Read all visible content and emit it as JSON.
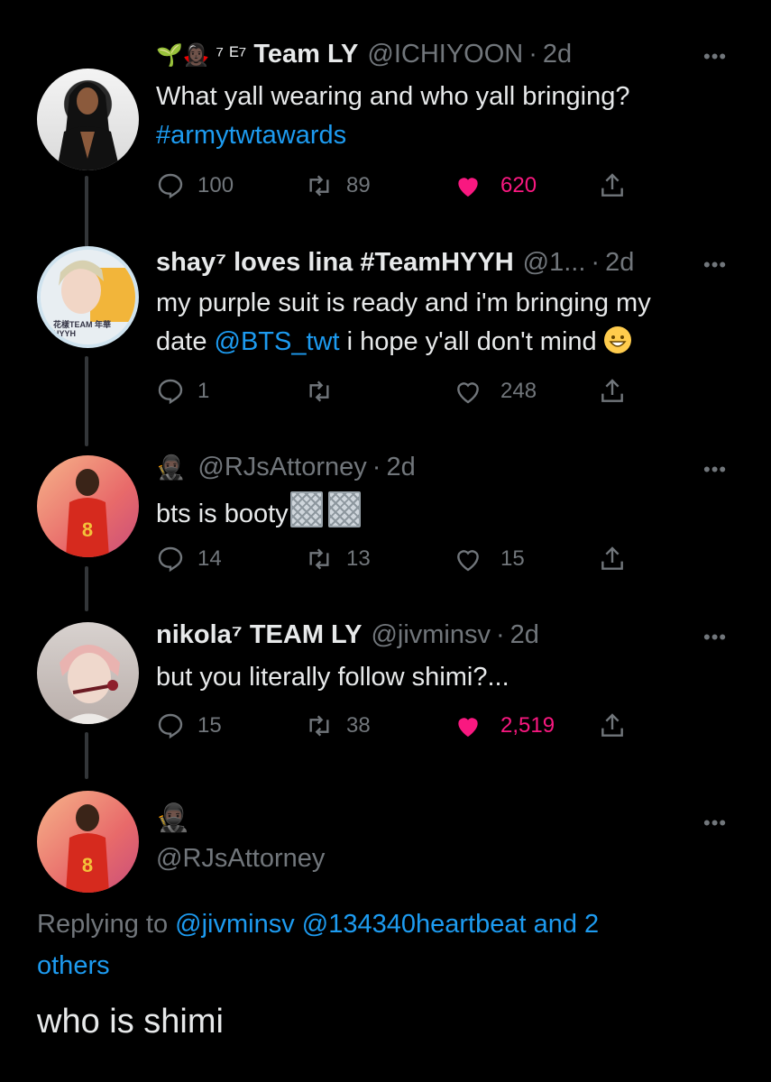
{
  "tweets": [
    {
      "emoji_prefix": "🌱🧛🏿‍♀️ ⁷ ᴱ⁷",
      "name": "Team LY",
      "handle": "@ICHIYOON",
      "time": "2d",
      "text_line1": "What yall wearing and who yall bringing?",
      "hashtag": "#armytwtawards",
      "replies": "100",
      "retweets": "89",
      "likes": "620",
      "liked": true
    },
    {
      "name": "shay⁷ loves lina #TeamHYYH",
      "handle": "@1...",
      "time": "2d",
      "avatar_badge": "花樣TEAM 年華HYYH",
      "text_line1": "my purple suit is ready and i'm bringing my",
      "text_line2_pre": "date ",
      "mention": "@BTS_twt",
      "text_line2_post": " i hope y'all don't mind",
      "replies": "1",
      "retweets": "",
      "likes": "248",
      "liked": false
    },
    {
      "emoji_prefix": "🥷🏿",
      "handle": "@RJsAttorney",
      "time": "2d",
      "text": "bts is booty",
      "replies": "14",
      "retweets": "13",
      "likes": "15",
      "liked": false
    },
    {
      "name": "nikola⁷ TEAM LY",
      "handle": "@jivminsv",
      "time": "2d",
      "text": "but you literally follow shimi?...",
      "replies": "15",
      "retweets": "38",
      "likes": "2,519",
      "liked": true
    }
  ],
  "focused": {
    "emoji": "🥷🏿",
    "handle": "@RJsAttorney",
    "replying_label": "Replying to",
    "replying_links": "@jivminsv @134340heartbeat and 2",
    "replying_others": "others",
    "text": "who is shimi"
  },
  "more_label": "•••",
  "colors": {
    "background": "#000000",
    "link": "#1d9bf0",
    "like": "#f91880",
    "muted": "#71767b"
  }
}
